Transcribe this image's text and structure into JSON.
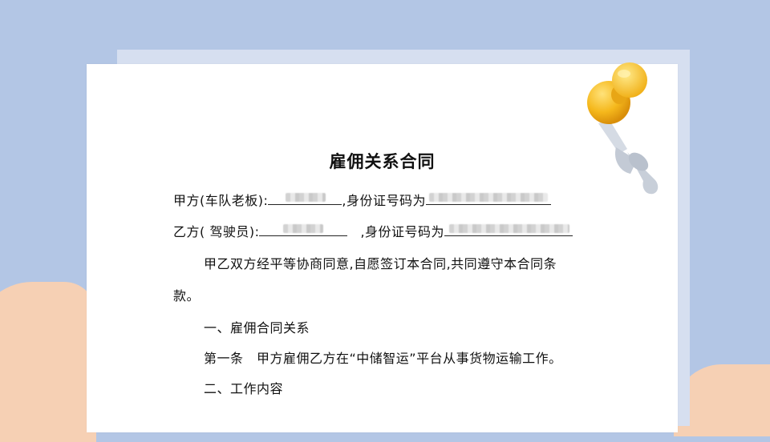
{
  "contract": {
    "title": "雇佣关系合同",
    "party_a_label": "甲方(车队老板):",
    "party_a_id_label": ",身份证号码为",
    "party_b_label": "乙方( 驾驶员):",
    "party_b_id_label": ",身份证号码为",
    "intro_line1": "甲乙双方经平等协商同意,自愿签订本合同,共同遵守本合同条",
    "intro_line2": "款。",
    "section1_heading": "一、雇佣合同关系",
    "article1": "第一条　甲方雇佣乙方在“中储智运”平台从事货物运输工作。",
    "section2_heading": "二、工作内容"
  },
  "colors": {
    "background": "#b3c6e5",
    "paper": "#ffffff",
    "skin": "#f6d0b4",
    "pin_head": "#f5b81c",
    "pin_needle": "#c8cfd9"
  },
  "icons": [
    "pushpin-icon"
  ]
}
